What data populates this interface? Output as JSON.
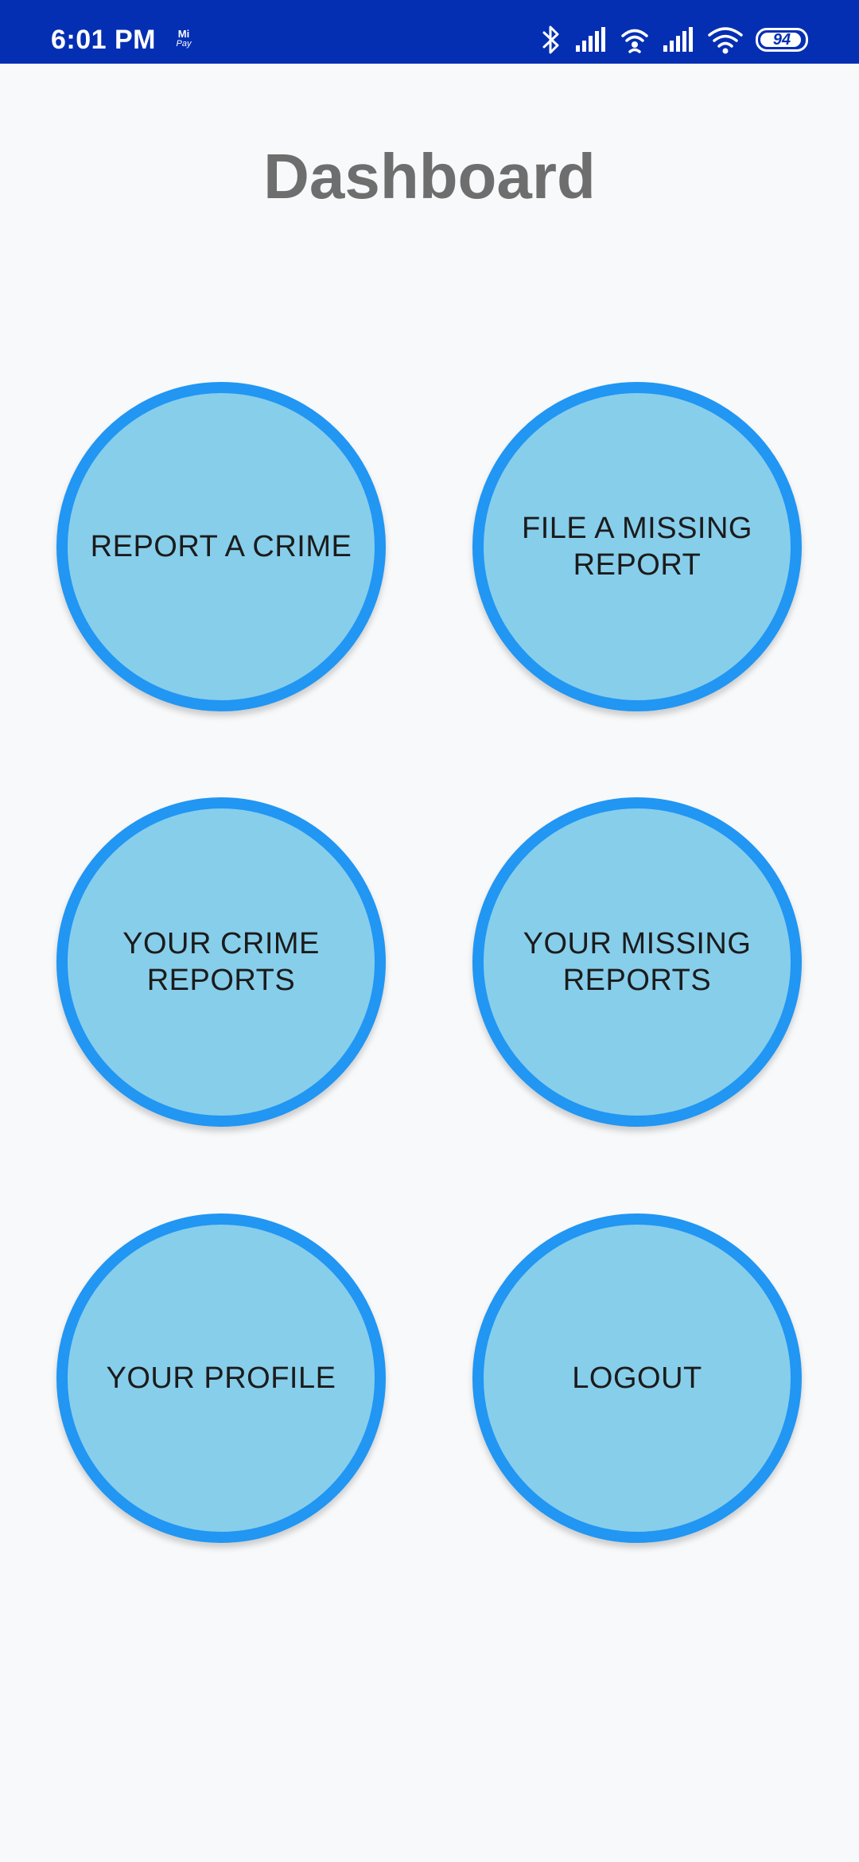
{
  "status_bar": {
    "time": "6:01 PM",
    "mipay_top": "Mi",
    "mipay_bottom": "Pay",
    "battery_level": "94",
    "battery_fraction": 0.94,
    "background_color": "#052FB3",
    "icons": [
      "bluetooth-icon",
      "signal-icon",
      "hotspot-icon",
      "signal-icon",
      "wifi-icon",
      "battery-icon"
    ]
  },
  "page": {
    "title": "Dashboard",
    "title_color": "#6E6E6E",
    "background_color": "#F8F9FA"
  },
  "buttons": [
    {
      "label": "REPORT A CRIME"
    },
    {
      "label": "FILE A MISSING\nREPORT"
    },
    {
      "label": "YOUR CRIME\nREPORTS"
    },
    {
      "label": "YOUR MISSING\nREPORTS"
    },
    {
      "label": "YOUR PROFILE"
    },
    {
      "label": "LOGOUT"
    }
  ],
  "button_style": {
    "fill_color": "#87CEEB",
    "border_color": "#2196F3",
    "text_color": "#1B1B1B"
  }
}
